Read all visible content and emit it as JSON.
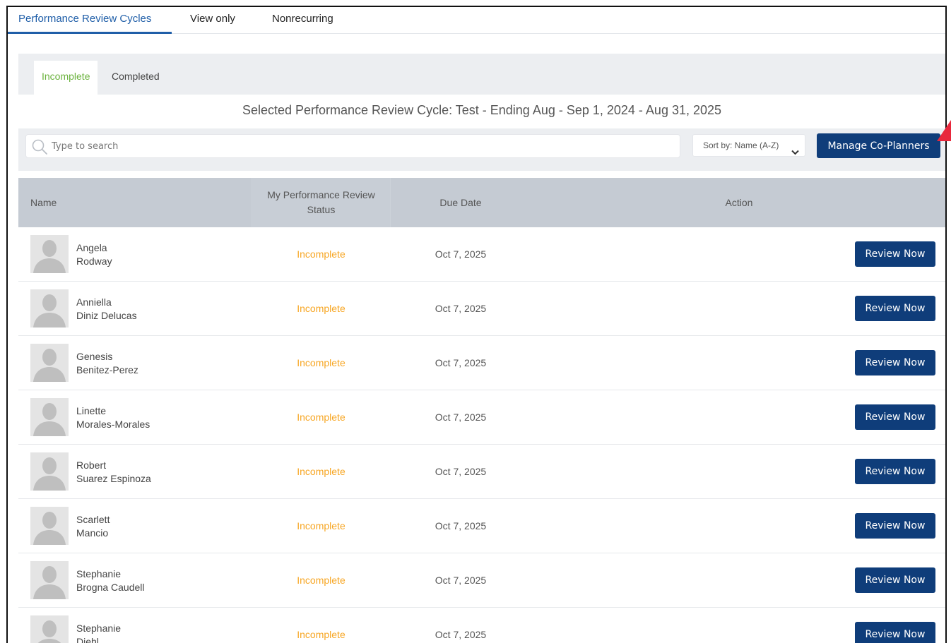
{
  "top_tabs": [
    {
      "label": "Performance Review Cycles",
      "active": true
    },
    {
      "label": "View only",
      "active": false
    },
    {
      "label": "Nonrecurring",
      "active": false
    }
  ],
  "sub_tabs": [
    {
      "label": "Incomplete",
      "active": true
    },
    {
      "label": "Completed",
      "active": false
    }
  ],
  "cycle_title": "Selected Performance Review Cycle: Test - Ending Aug - Sep 1, 2024 - Aug 31, 2025",
  "search": {
    "placeholder": "Type to search",
    "value": ""
  },
  "sort": {
    "selected": "Sort by: Name (A-Z)"
  },
  "manage_button": "Manage Co-Planners",
  "columns": {
    "name": "Name",
    "status_line1": "My Performance Review",
    "status_line2": "Status",
    "due": "Due Date",
    "action": "Action"
  },
  "rows": [
    {
      "first": "Angela",
      "last": "Rodway",
      "status": "Incomplete",
      "due": "Oct 7, 2025",
      "action": "Review Now"
    },
    {
      "first": "Anniella",
      "last": "Diniz Delucas",
      "status": "Incomplete",
      "due": "Oct 7, 2025",
      "action": "Review Now"
    },
    {
      "first": "Genesis",
      "last": "Benitez-Perez",
      "status": "Incomplete",
      "due": "Oct 7, 2025",
      "action": "Review Now"
    },
    {
      "first": "Linette",
      "last": "Morales-Morales",
      "status": "Incomplete",
      "due": "Oct 7, 2025",
      "action": "Review Now"
    },
    {
      "first": "Robert",
      "last": "Suarez Espinoza",
      "status": "Incomplete",
      "due": "Oct 7, 2025",
      "action": "Review Now"
    },
    {
      "first": "Scarlett",
      "last": "Mancio",
      "status": "Incomplete",
      "due": "Oct 7, 2025",
      "action": "Review Now"
    },
    {
      "first": "Stephanie",
      "last": "Brogna Caudell",
      "status": "Incomplete",
      "due": "Oct 7, 2025",
      "action": "Review Now"
    },
    {
      "first": "Stephanie",
      "last": "Diehl",
      "status": "Incomplete",
      "due": "Oct 7, 2025",
      "action": "Review Now"
    }
  ],
  "colors": {
    "primary_button": "#0f3d7a",
    "active_tab": "#1f5ea8",
    "active_subtab": "#6cb33f",
    "status_incomplete": "#f7a623",
    "annotation_arrow": "#e8283c"
  },
  "icons": {
    "search": "search-icon",
    "sort_chevron": "chevron-down-icon",
    "avatar": "user-placeholder-icon",
    "annotation": "arrow-annotation-icon"
  }
}
